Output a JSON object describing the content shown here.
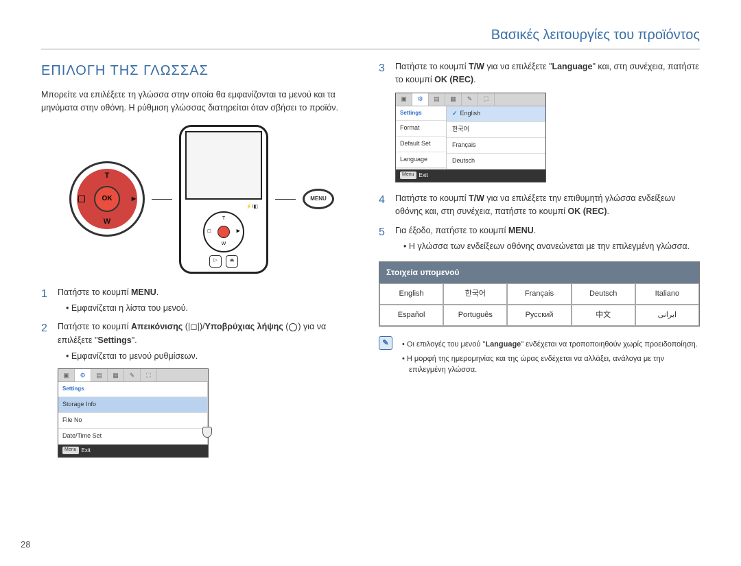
{
  "header": {
    "title": "Βασικές λειτουργίες του προϊόντος"
  },
  "section_title": "ΕΠΙΛΟΓΗ ΤΗΣ ΓΛΩΣΣΑΣ",
  "intro": "Μπορείτε να επιλέξετε τη γλώσσα στην οποία θα εμφανίζονται τα μενού και τα μηνύματα στην οθόνη. Η ρύθμιση γλώσσας διατηρείται όταν σβήσει το προϊόν.",
  "dpad": {
    "t": "T",
    "w": "W",
    "ok": "OK",
    "menu": "MENU"
  },
  "mini": {
    "t": "T",
    "w": "W",
    "l": "◻",
    "r": "▶"
  },
  "small_btns": {
    "a": "▷",
    "b": "⏏"
  },
  "steps_left": [
    {
      "num": "1",
      "text_parts": [
        "Πατήστε το κουμπί ",
        "MENU",
        "."
      ],
      "bullets": [
        "Εμφανίζεται η λίστα του μενού."
      ]
    },
    {
      "num": "2",
      "text_parts": [
        "Πατήστε το κουμπί ",
        "Απεικόνισης",
        " (|◻|)/",
        "Υποβρύχιας λήψης",
        " (",
        ") για να επιλέξετε \"",
        "Settings",
        "\"."
      ],
      "bullets": [
        "Εμφανίζεται το μενού ρυθμίσεων."
      ]
    }
  ],
  "steps_right": [
    {
      "num": "3",
      "text_parts": [
        "Πατήστε το κουμπί ",
        "T/W",
        " για να επιλέξετε \"",
        "Language",
        "\" και, στη συνέχεια, πατήστε το κουμπί ",
        "OK (REC)",
        "."
      ]
    },
    {
      "num": "4",
      "text_parts": [
        "Πατήστε το κουμπί ",
        "T/W",
        " για να επιλέξετε την επιθυμητή γλώσσα ενδείξεων οθόνης και, στη συνέχεια, πατήστε το κουμπί ",
        "OK (REC)",
        "."
      ]
    },
    {
      "num": "5",
      "text_parts": [
        "Για έξοδο, πατήστε το κουμπί ",
        "MENU",
        "."
      ],
      "bullets": [
        "Η γλώσσα των ενδείξεων οθόνης ανανεώνεται με την επιλεγμένη γλώσσα."
      ]
    }
  ],
  "screenshot1": {
    "header": "Settings",
    "rows": [
      "Storage Info",
      "File No",
      "Date/Time Set"
    ],
    "exit_label": "Exit",
    "menu_chip": "Menu"
  },
  "screenshot2": {
    "header": "Settings",
    "left_rows": [
      "Format",
      "Default Set",
      "Language"
    ],
    "langs": [
      "English",
      "한국어",
      "Français",
      "Deutsch"
    ],
    "exit_label": "Exit",
    "menu_chip": "Menu"
  },
  "submenu": {
    "title": "Στοιχεία υπομενού",
    "items": [
      "English",
      "한국어",
      "Français",
      "Deutsch",
      "Italiano",
      "Español",
      "Português",
      "Русский",
      "中文",
      "ایرانی"
    ]
  },
  "notes": [
    "Οι επιλογές του μενού \"Language\" ενδέχεται να τροποποιηθούν χωρίς προειδοποίηση.",
    "Η μορφή της ημερομηνίας και της ώρας ενδέχεται να αλλάξει, ανάλογα με την επιλεγμένη γλώσσα."
  ],
  "note_icon": "✎",
  "page_number": "28"
}
